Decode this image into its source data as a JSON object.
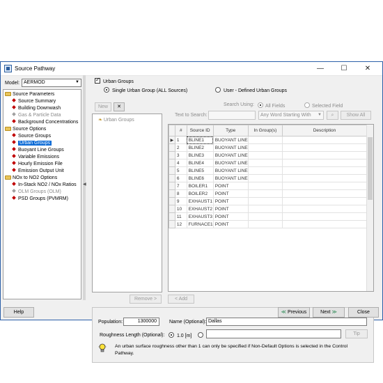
{
  "window": {
    "title": "Source Pathway",
    "controls": {
      "minimize": "—",
      "maximize": "☐",
      "close": "✕"
    }
  },
  "model": {
    "label": "Model:",
    "value": "AERMOD"
  },
  "tree": [
    {
      "label": "Source Parameters",
      "type": "folder",
      "enabled": true
    },
    {
      "label": "Source Summary",
      "type": "item",
      "enabled": true
    },
    {
      "label": "Building Downwash",
      "type": "item",
      "enabled": true
    },
    {
      "label": "Gas & Particle Data",
      "type": "item",
      "enabled": false
    },
    {
      "label": "Background Concentrations",
      "type": "item",
      "enabled": true
    },
    {
      "label": "Source Options",
      "type": "folder",
      "enabled": true
    },
    {
      "label": "Source Groups",
      "type": "item",
      "enabled": true
    },
    {
      "label": "Urban Groups",
      "type": "item",
      "enabled": true,
      "selected": true
    },
    {
      "label": "Buoyant Line Groups",
      "type": "item",
      "enabled": true
    },
    {
      "label": "Variable Emissions",
      "type": "item",
      "enabled": true
    },
    {
      "label": "Hourly Emission File",
      "type": "item",
      "enabled": true
    },
    {
      "label": "Emission Output Unit",
      "type": "item",
      "enabled": true
    },
    {
      "label": "NOx to NO2 Options",
      "type": "folder",
      "enabled": true
    },
    {
      "label": "In-Stack NO2 / NOx Ratios",
      "type": "item",
      "enabled": true
    },
    {
      "label": "OLM Groups (OLM)",
      "type": "item",
      "enabled": false
    },
    {
      "label": "PSD Groups (PVMRM)",
      "type": "item",
      "enabled": true
    }
  ],
  "urban": {
    "checkbox_label": "Urban Groups",
    "single_label": "Single Urban Group (ALL Sources)",
    "user_label": "User - Defined Urban Groups"
  },
  "groups": {
    "new_label": "New",
    "delete_icon": "✕",
    "root_label": "Urban Groups",
    "remove_label": "Remove  >",
    "add_label": "<  Add"
  },
  "search": {
    "text_label": "Text to Search:",
    "using_label": "Search Using:",
    "all_fields": "All Fields",
    "selected_field": "Selected Field",
    "mode": "Any Word Starting With",
    "show_all": "Show All"
  },
  "table": {
    "headers": [
      "#",
      "Source ID",
      "Type",
      "In Group(s)",
      "Description"
    ],
    "rows": [
      [
        "1",
        "BLINE1",
        "BUOYANT LINE",
        "",
        ""
      ],
      [
        "2",
        "BLINE2",
        "BUOYANT LINE",
        "",
        ""
      ],
      [
        "3",
        "BLINE3",
        "BUOYANT LINE",
        "",
        ""
      ],
      [
        "4",
        "BLINE4",
        "BUOYANT LINE",
        "",
        ""
      ],
      [
        "5",
        "BLINE5",
        "BUOYANT LINE",
        "",
        ""
      ],
      [
        "6",
        "BLINE6",
        "BUOYANT LINE",
        "",
        ""
      ],
      [
        "7",
        "BOILER1",
        "POINT",
        "",
        ""
      ],
      [
        "8",
        "BOILER2",
        "POINT",
        "",
        ""
      ],
      [
        "9",
        "EXHAUST1",
        "POINT",
        "",
        ""
      ],
      [
        "10",
        "EXHAUST2",
        "POINT",
        "",
        ""
      ],
      [
        "11",
        "EXHAUST3",
        "POINT",
        "",
        ""
      ],
      [
        "12",
        "FURNACE1",
        "POINT",
        "",
        ""
      ]
    ]
  },
  "settings": {
    "population_label": "Population:",
    "population_value": "1300000",
    "name_label": "Name (Optional):",
    "name_value": "Dallas",
    "roughness_label": "Roughness Length (Optional):",
    "roughness_default": "1.0 [m]",
    "tip_label": "Tip",
    "note": "An urban surface roughness other than 1 can only be specified if Non-Default Options is selected in the Control Pathway."
  },
  "footer": {
    "help": "Help",
    "previous": "Previous",
    "next": "Next",
    "close": "Close"
  },
  "colors": {
    "accent": "#0a6ad6",
    "window_border": "#2b5fa8",
    "diamond": "#c00000",
    "nav_arrow": "#2e8b57"
  }
}
